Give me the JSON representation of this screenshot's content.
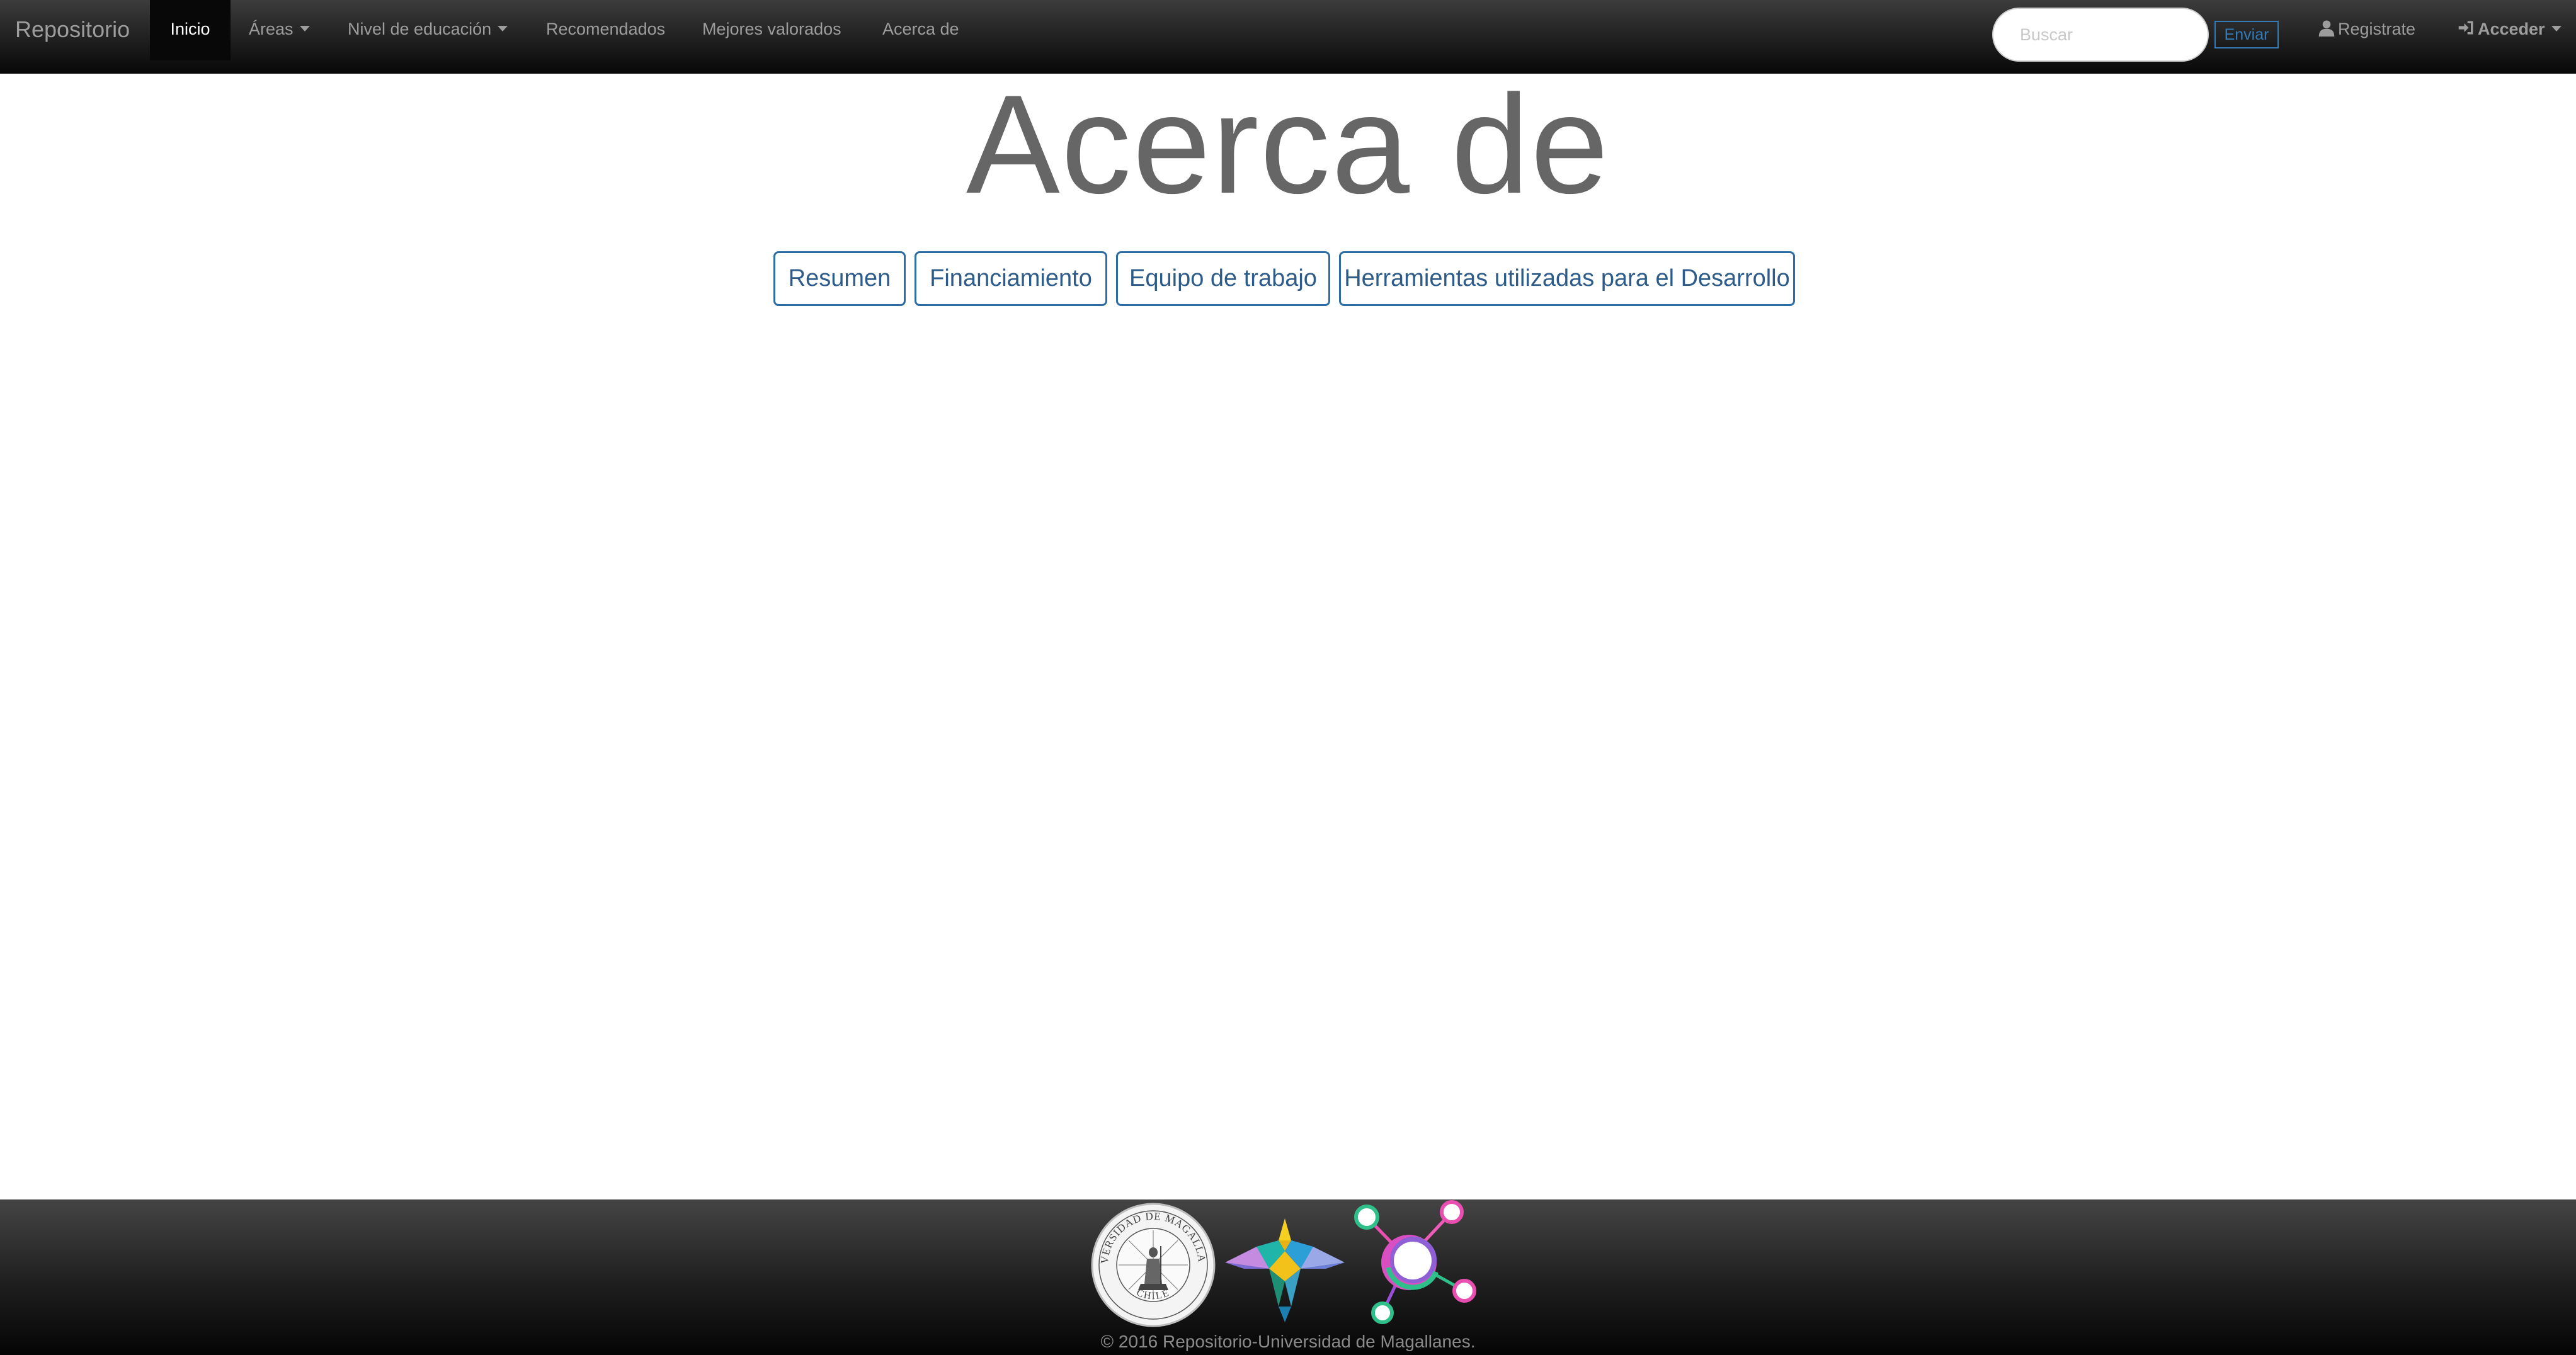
{
  "navbar": {
    "brand": "Repositorio",
    "items": [
      {
        "label": "Inicio",
        "active": true,
        "dropdown": false
      },
      {
        "label": "Áreas",
        "active": false,
        "dropdown": true
      },
      {
        "label": "Nivel de educación",
        "active": false,
        "dropdown": true
      },
      {
        "label": "Recomendados",
        "active": false,
        "dropdown": false
      },
      {
        "label": "Mejores valorados",
        "active": false,
        "dropdown": false
      },
      {
        "label": "Acerca de",
        "active": false,
        "dropdown": false
      }
    ],
    "search": {
      "placeholder": "Buscar",
      "value": ""
    },
    "submit_label": "Enviar",
    "register_label": "Registrate",
    "login_label": "Acceder",
    "icons": {
      "register": "user-icon",
      "login": "login-icon"
    }
  },
  "main": {
    "title": "Acerca de",
    "tabs": [
      {
        "label": "Resumen"
      },
      {
        "label": "Financiamiento"
      },
      {
        "label": "Equipo de trabajo"
      },
      {
        "label": "Herramientas utilizadas para el Desarrollo"
      }
    ]
  },
  "footer": {
    "logos": [
      {
        "name": "universidad-de-magallanes-seal",
        "text": "UNIVERSIDAD DE MAGALLANES CHILE"
      },
      {
        "name": "bird-logo"
      },
      {
        "name": "molecule-logo"
      }
    ],
    "copyright": "© 2016 Repositorio-Universidad de Magallanes."
  },
  "colors": {
    "navbar_bg": "#222222",
    "nav_text": "#9d9d9d",
    "nav_active_bg": "#080808",
    "link": "#337ab7",
    "title": "#666666"
  }
}
